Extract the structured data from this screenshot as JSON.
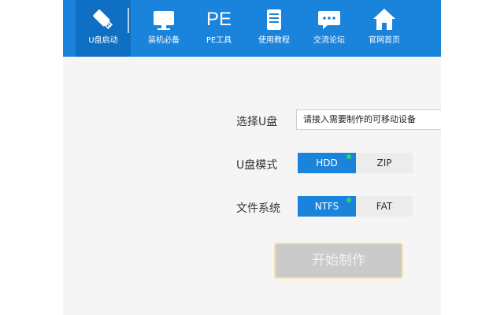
{
  "nav": [
    {
      "label": "U盘启动",
      "icon": "usb-drive-icon",
      "active": true
    },
    {
      "label": "装机必备",
      "icon": "monitor-icon",
      "active": false
    },
    {
      "label": "PE工具",
      "icon": "pe-text-icon",
      "icon_text": "PE",
      "active": false
    },
    {
      "label": "使用教程",
      "icon": "book-icon",
      "active": false
    },
    {
      "label": "交流论坛",
      "icon": "chat-bubble-icon",
      "active": false
    },
    {
      "label": "官网首页",
      "icon": "home-icon",
      "active": false
    }
  ],
  "form": {
    "usb_label": "选择U盘",
    "usb_value": "请接入需要制作的可移动设备",
    "mode_label": "U盘模式",
    "mode_options": [
      "HDD",
      "ZIP"
    ],
    "mode_selected": "HDD",
    "fs_label": "文件系统",
    "fs_options": [
      "NTFS",
      "FAT"
    ],
    "fs_selected": "NTFS"
  },
  "start_button": "开始制作",
  "colors": {
    "accent": "#1a84dc",
    "indicator": "#2fd36a"
  }
}
